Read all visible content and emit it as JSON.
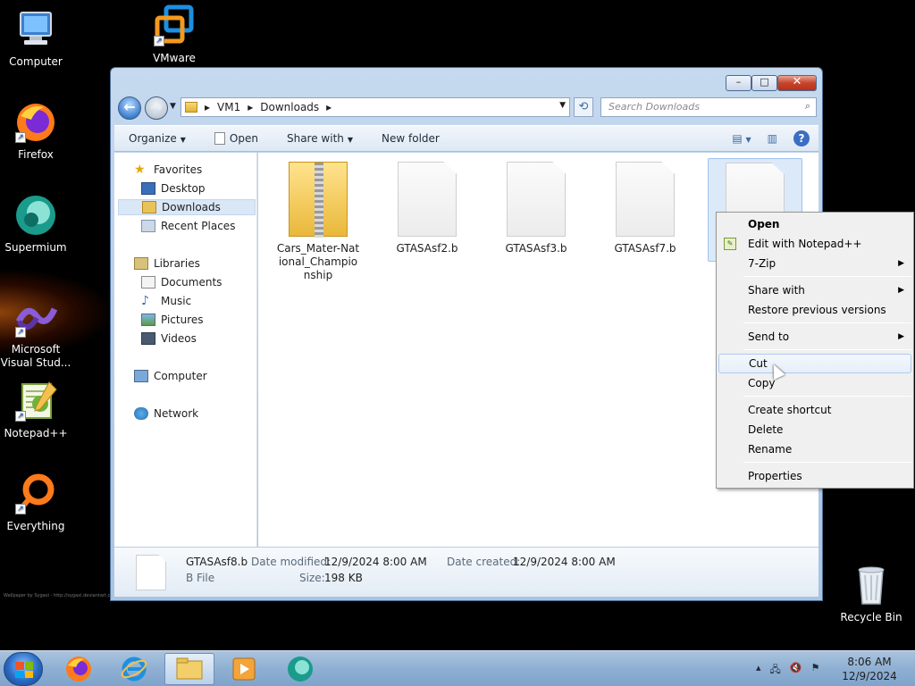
{
  "desktop": {
    "icons": [
      {
        "label": "Computer"
      },
      {
        "label": "VMware"
      },
      {
        "label": "Firefox"
      },
      {
        "label": "Supermium"
      },
      {
        "label": "Microsoft\nVisual Stud..."
      },
      {
        "label": "Notepad++"
      },
      {
        "label": "Everything"
      },
      {
        "label": "Recycle Bin"
      }
    ],
    "watermark": "Wallpaper by Sygaxi - http://sygaxi.deviantart.com"
  },
  "window": {
    "controls": {
      "minimize": "–",
      "maximize": "□",
      "close": "✕"
    },
    "breadcrumb": [
      "VM1",
      "Downloads"
    ],
    "search_placeholder": "Search Downloads",
    "commands": [
      "Organize",
      "Open",
      "Share with",
      "New folder"
    ],
    "nav": {
      "favorites": "Favorites",
      "desktop": "Desktop",
      "downloads": "Downloads",
      "recent": "Recent Places",
      "libraries": "Libraries",
      "documents": "Documents",
      "music": "Music",
      "pictures": "Pictures",
      "videos": "Videos",
      "computer": "Computer",
      "network": "Network"
    },
    "files": [
      {
        "name": "Cars_Mater-National_Championship",
        "type": "zip"
      },
      {
        "name": "GTASAsf2.b",
        "type": "file"
      },
      {
        "name": "GTASAsf3.b",
        "type": "file"
      },
      {
        "name": "GTASAsf7.b",
        "type": "file"
      },
      {
        "name": "",
        "type": "file",
        "selected": true
      }
    ],
    "details": {
      "name": "GTASAsf8.b",
      "type": "B File",
      "modified_label": "Date modified:",
      "modified": "12/9/2024 8:00 AM",
      "created_label": "Date created:",
      "created": "12/9/2024 8:00 AM",
      "size_label": "Size:",
      "size": "198 KB"
    }
  },
  "context_menu": {
    "items": [
      {
        "label": "Open",
        "bold": true
      },
      {
        "label": "Edit with Notepad++"
      },
      {
        "label": "7-Zip",
        "submenu": true
      },
      {
        "label": "Share with",
        "submenu": true
      },
      {
        "label": "Restore previous versions"
      },
      {
        "label": "Send to",
        "submenu": true
      },
      {
        "label": "Cut",
        "highlighted": true
      },
      {
        "label": "Copy"
      },
      {
        "label": "Create shortcut"
      },
      {
        "label": "Delete"
      },
      {
        "label": "Rename"
      },
      {
        "label": "Properties"
      }
    ]
  },
  "taskbar": {
    "time": "8:06 AM",
    "date": "12/9/2024",
    "tray_chevron": "▴"
  }
}
